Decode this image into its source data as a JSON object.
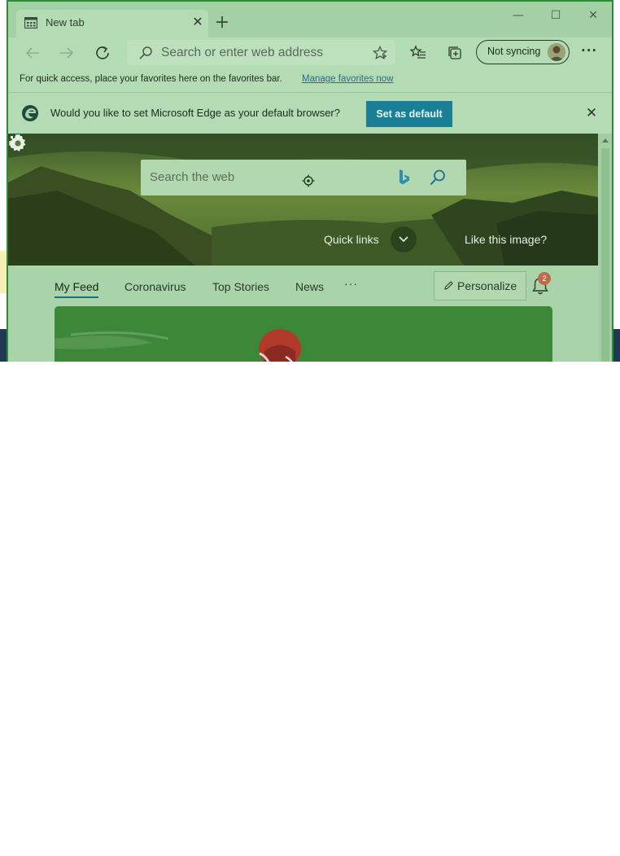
{
  "tab": {
    "title": "New tab",
    "close_glyph": "✕",
    "new_tab_glyph": "+"
  },
  "window_controls": {
    "minimize": "—",
    "maximize": "☐",
    "close": "✕"
  },
  "toolbar": {
    "address_placeholder": "Search or enter web address",
    "sync_label": "Not syncing",
    "more_glyph": "···"
  },
  "favorites_bar": {
    "message": "For quick access, place your favorites here on the favorites bar.",
    "link": "Manage favorites now"
  },
  "infobar": {
    "message": "Would you like to set Microsoft Edge as your default browser?",
    "button": "Set as default",
    "close_glyph": "✕"
  },
  "hero": {
    "search_placeholder": "Search the web",
    "quick_links": "Quick links",
    "like_image": "Like this image?"
  },
  "feed": {
    "tabs": [
      "My Feed",
      "Coronavirus",
      "Top Stories",
      "News"
    ],
    "more_glyph": "···",
    "personalize": "Personalize",
    "notification_count": "2"
  },
  "colors": {
    "accent": "#1a7e94",
    "overlay": "#a9d4a9",
    "badge": "#c06a4e"
  }
}
